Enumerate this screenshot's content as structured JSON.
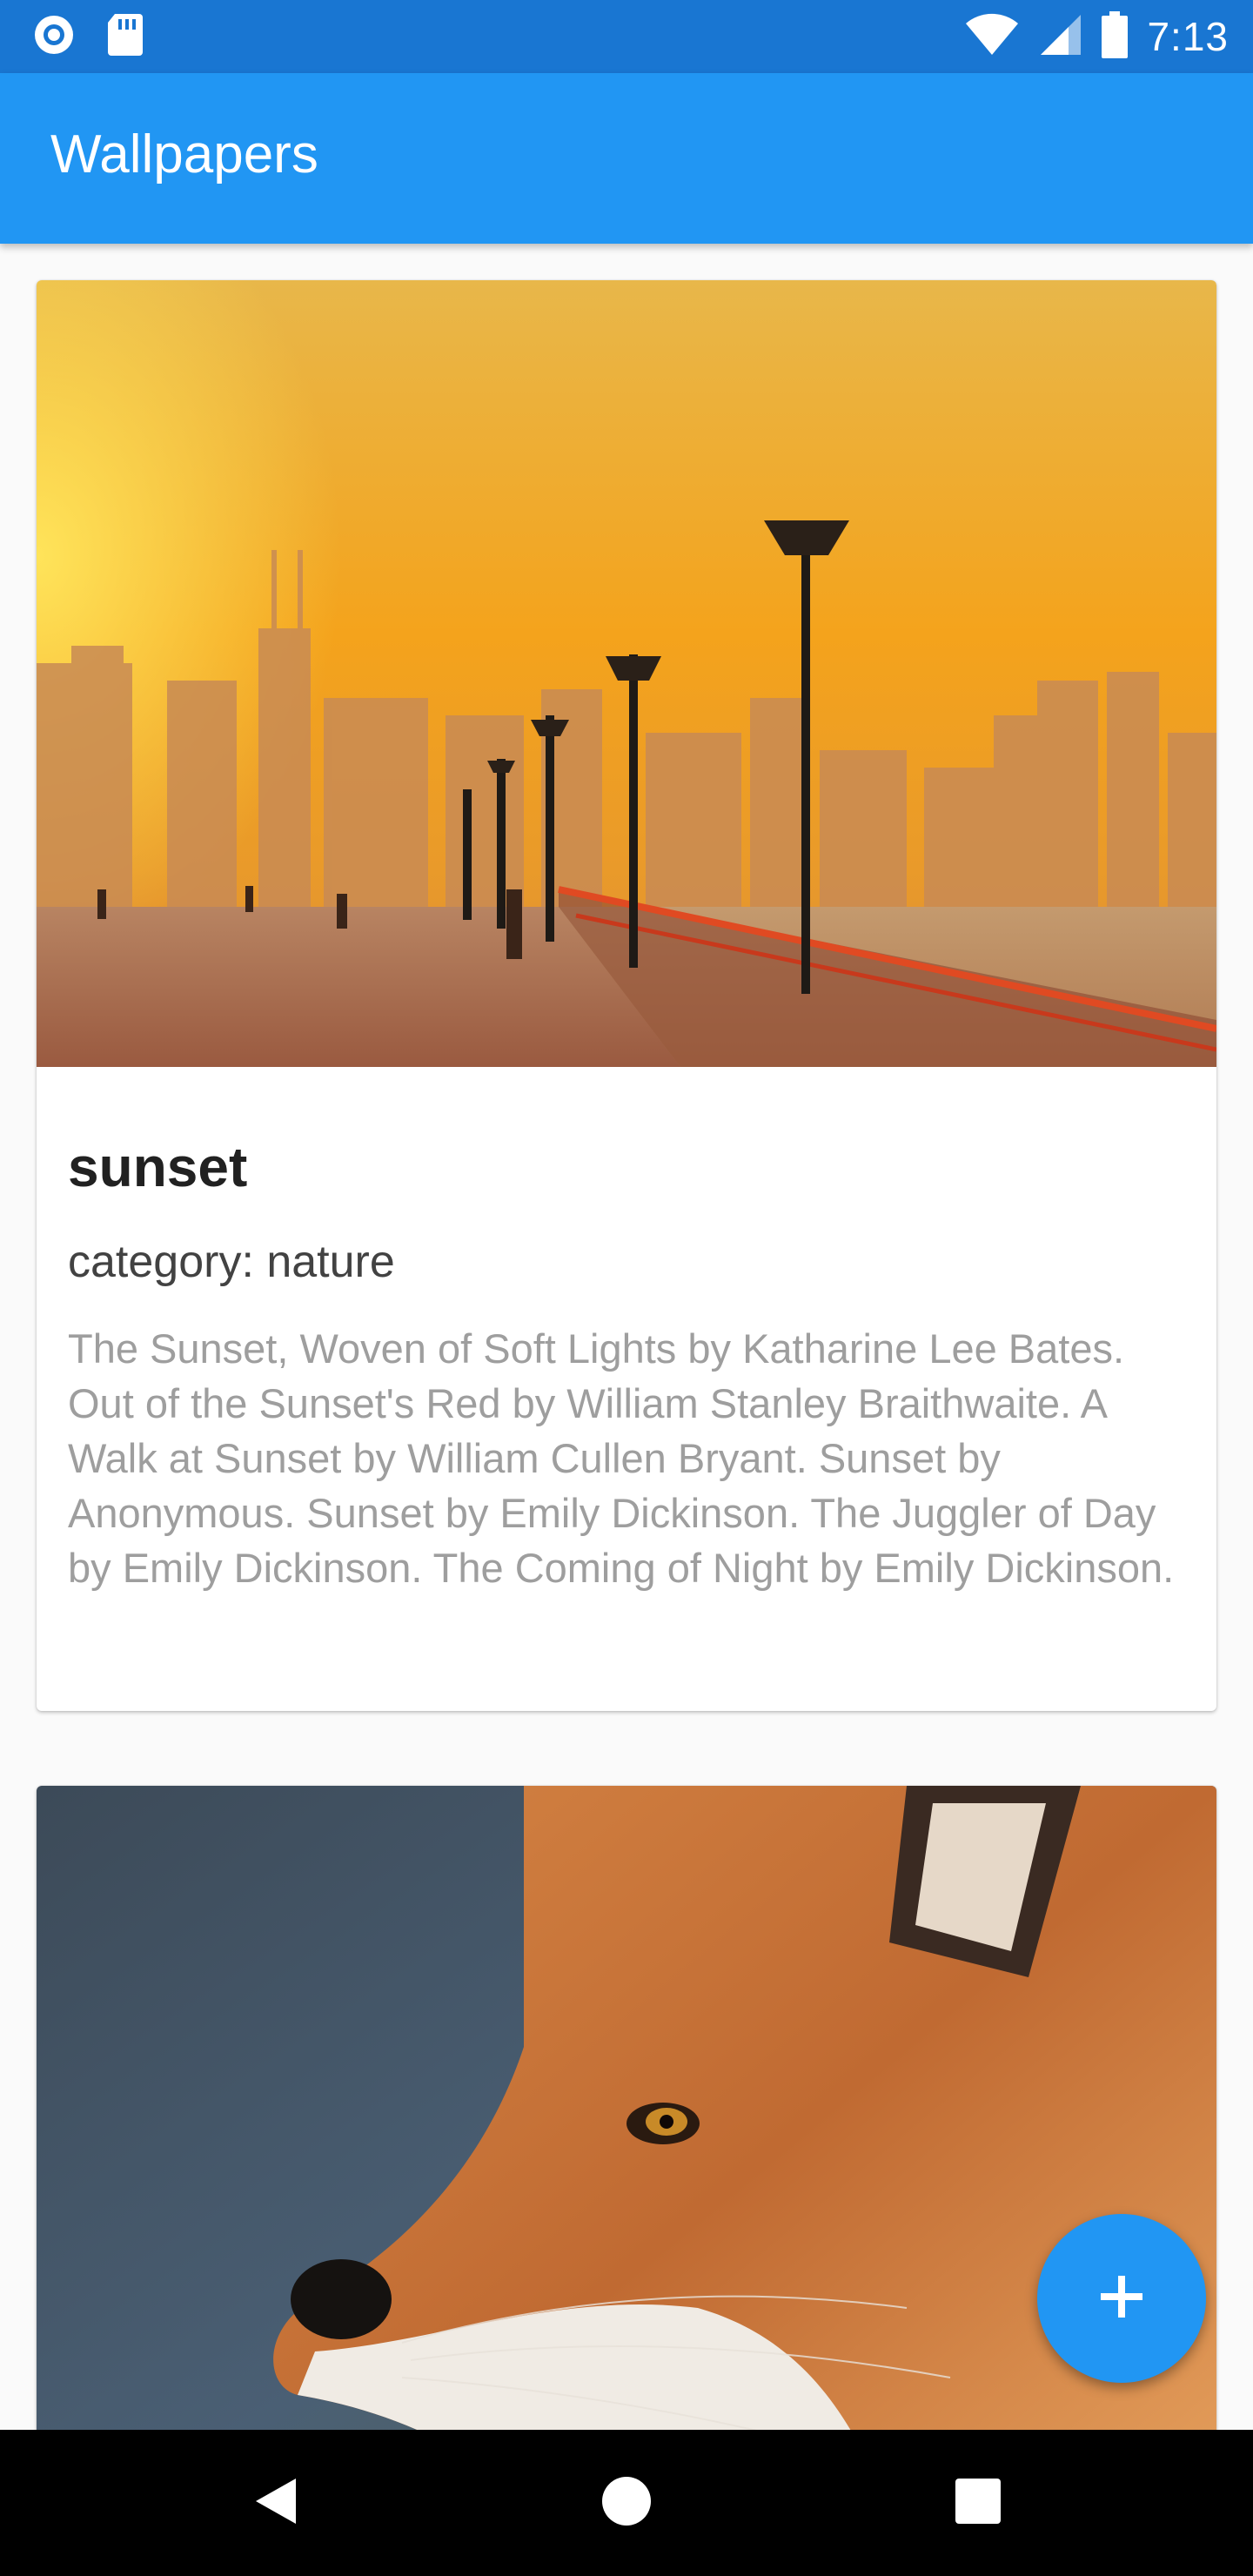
{
  "status_bar": {
    "time": "7:13",
    "icons": [
      "notification-circle-icon",
      "sd-card-icon",
      "wifi-icon",
      "cell-signal-icon",
      "battery-icon"
    ]
  },
  "app_bar": {
    "title": "Wallpapers"
  },
  "cards": [
    {
      "image_icon": "sunset-promenade-photo",
      "title": "sunset",
      "category": "category: nature",
      "description": "The Sunset, Woven of Soft Lights by Katharine Lee Bates. Out of the Sunset's Red by William Stanley Braithwaite. A Walk at Sunset by William Cullen Bryant. Sunset by Anonymous. Sunset by Emily Dickinson. The Juggler of Day by Emily Dickinson. The Coming of Night by Emily Dickinson."
    },
    {
      "image_icon": "fox-photo"
    }
  ],
  "fab": {
    "icon": "plus-icon"
  },
  "nav_bar": {
    "icons": [
      "back-icon",
      "home-icon",
      "recents-icon"
    ]
  },
  "colors": {
    "status_bar": "#1976d2",
    "app_bar": "#2196f3",
    "fab": "#2196f3",
    "title_text": "#212121",
    "category_text": "#424242",
    "description_text": "#9e9e9e"
  }
}
